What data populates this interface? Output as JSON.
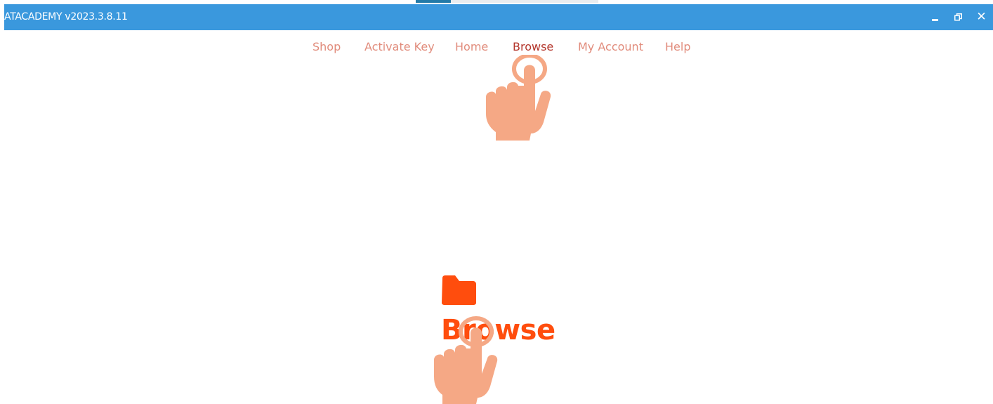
{
  "window": {
    "title": "ATACADEMY v2023.3.8.11",
    "controls": {
      "minimize_icon": "minimize-icon",
      "restore_icon": "restore-icon",
      "close_icon": "close-icon",
      "close_glyph": "✕"
    },
    "title_bar_color": "#3a98dd"
  },
  "nav": {
    "items": [
      {
        "label": "Shop",
        "active": false
      },
      {
        "label": "Activate Key",
        "active": false
      },
      {
        "label": "Home",
        "active": false
      },
      {
        "label": "Browse",
        "active": true
      },
      {
        "label": "My Account",
        "active": false
      },
      {
        "label": "Help",
        "active": false
      }
    ],
    "link_color": "#e18c7c",
    "active_color": "#b4372d"
  },
  "main": {
    "browse_button": {
      "label": "Browse",
      "icon": "folder-icon",
      "color": "#ff4d0d"
    }
  },
  "overlays": {
    "pointer_icon": "tap-hand-icon",
    "hand_color": "#f5a885"
  }
}
